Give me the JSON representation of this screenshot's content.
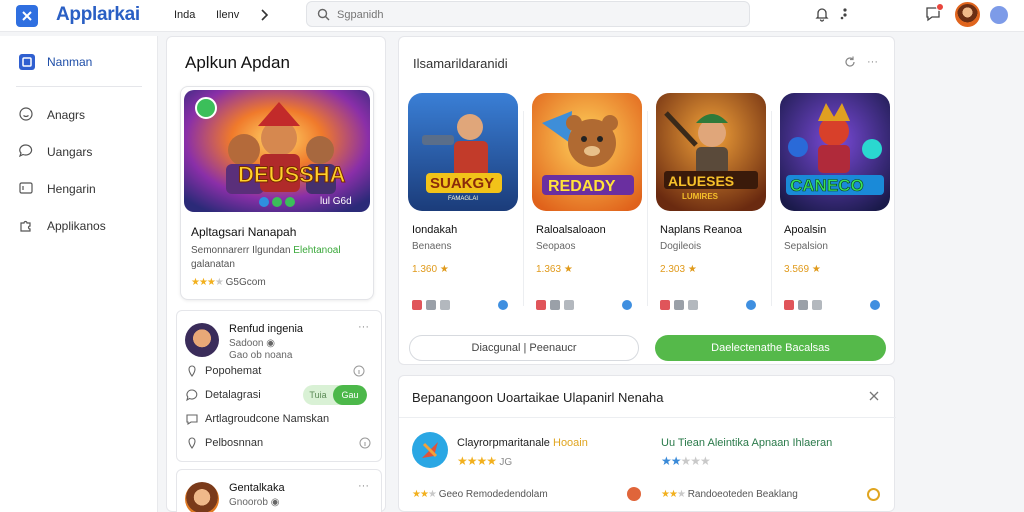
{
  "topbar": {
    "brand": "Applarkai",
    "nav": [
      "Inda",
      "Ilenv"
    ],
    "search_placeholder": "Sgpanidh"
  },
  "sidebar": {
    "items": [
      {
        "label": "Nanman",
        "icon": "square-icon",
        "active": true
      },
      {
        "label": "Anagrs",
        "icon": "smile-icon"
      },
      {
        "label": "Uangars",
        "icon": "chat-icon"
      },
      {
        "label": "Hengarin",
        "icon": "id-card-icon"
      },
      {
        "label": "Applikanos",
        "icon": "puzzle-icon"
      }
    ]
  },
  "left": {
    "title": "Aplkun Apdan",
    "featured": {
      "image_text": "DEUSSHA",
      "image_corner": "lul G6d",
      "name": "Apltagsari Nanapah",
      "desc_a": "Semonnarerr Ilgundan",
      "desc_hl": "Elehtanoal",
      "desc_b": "galanatan",
      "rating_text": "G5Gcom"
    },
    "comments": [
      {
        "name": "Renfud ingenia",
        "sub1": "Sadoon",
        "sub2": "Gao ob noana"
      },
      {
        "name": "Gentalkaka",
        "sub1": "Gnoorob"
      }
    ],
    "actions": [
      {
        "label": "Popohemat",
        "icon": "pin-icon"
      },
      {
        "label": "Detalagrasi",
        "icon": "chat-icon",
        "toggle_off": "Tuia",
        "toggle_on": "Gau"
      },
      {
        "label": "Artlagroudcone Namskan",
        "icon": "chat-icon"
      },
      {
        "label": "Pelbosnnan",
        "icon": "pin-icon"
      }
    ]
  },
  "apps_panel": {
    "title": "Ilsamarildaranidi",
    "apps": [
      {
        "name": "Iondakah",
        "category": "Benaens",
        "rating": "1.360",
        "tile_text": "SUAKGY",
        "tile_sub": "FAMAGLAI"
      },
      {
        "name": "Raloalsaloaon",
        "category": "Seopaos",
        "rating": "1.363",
        "tile_text": "REDADY",
        "tile_sub": ""
      },
      {
        "name": "Naplans Reanoa",
        "category": "Dogileois",
        "rating": "2.303",
        "tile_text": "ALUESES",
        "tile_sub": "LUMIRES"
      },
      {
        "name": "Apoalsin",
        "category": "Sepalsion",
        "rating": "3.569",
        "tile_text": "CANECO",
        "tile_sub": ""
      }
    ],
    "btn_secondary": "Diacgunal | Peenaucr",
    "btn_primary": "Daelectenathe Bacalsas"
  },
  "reviews_panel": {
    "title": "Bepanangoon Uoartaikae Ulapanirl Nenaha",
    "item1_name": "Clayrorpmaritanale",
    "item1_hl": "Hooain",
    "item1_count": "JG",
    "item1_foot": "Geeo Remodedendolam",
    "item2_name": "Uu Tiean Aleintika Apnaan Ihlaeran",
    "item2_foot": "Randoeoteden Beaklang"
  },
  "colors": {
    "accent": "#2f6fe0",
    "green": "#55b94a",
    "star": "#f2b01e"
  }
}
